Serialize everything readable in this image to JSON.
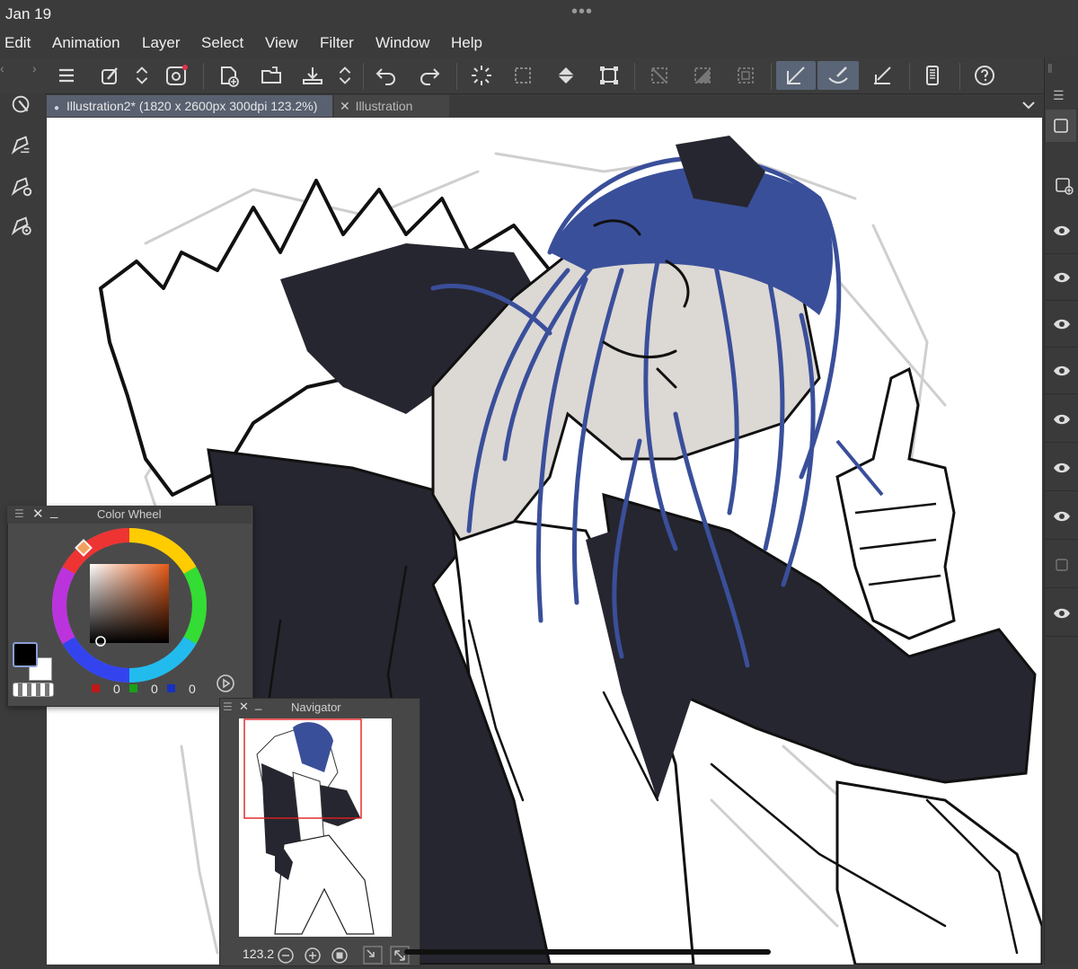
{
  "status": {
    "date": "Jan 19",
    "dots": "•••"
  },
  "menu": {
    "items": [
      "Edit",
      "Animation",
      "Layer",
      "Select",
      "View",
      "Filter",
      "Window",
      "Help"
    ]
  },
  "tabs": [
    {
      "label": "Illustration2* (1820 x 2600px 300dpi 123.2%)"
    },
    {
      "label": "Illustration"
    }
  ],
  "color_wheel": {
    "title": "Color Wheel",
    "r": "0",
    "g": "0",
    "b": "0",
    "main_color": "#000000",
    "sub_color": "#ffffff"
  },
  "navigator": {
    "title": "Navigator",
    "zoom": "123.2"
  },
  "colors": {
    "accent": "#5a6577",
    "hair": "#3a4f9a",
    "jacket": "#262630"
  }
}
